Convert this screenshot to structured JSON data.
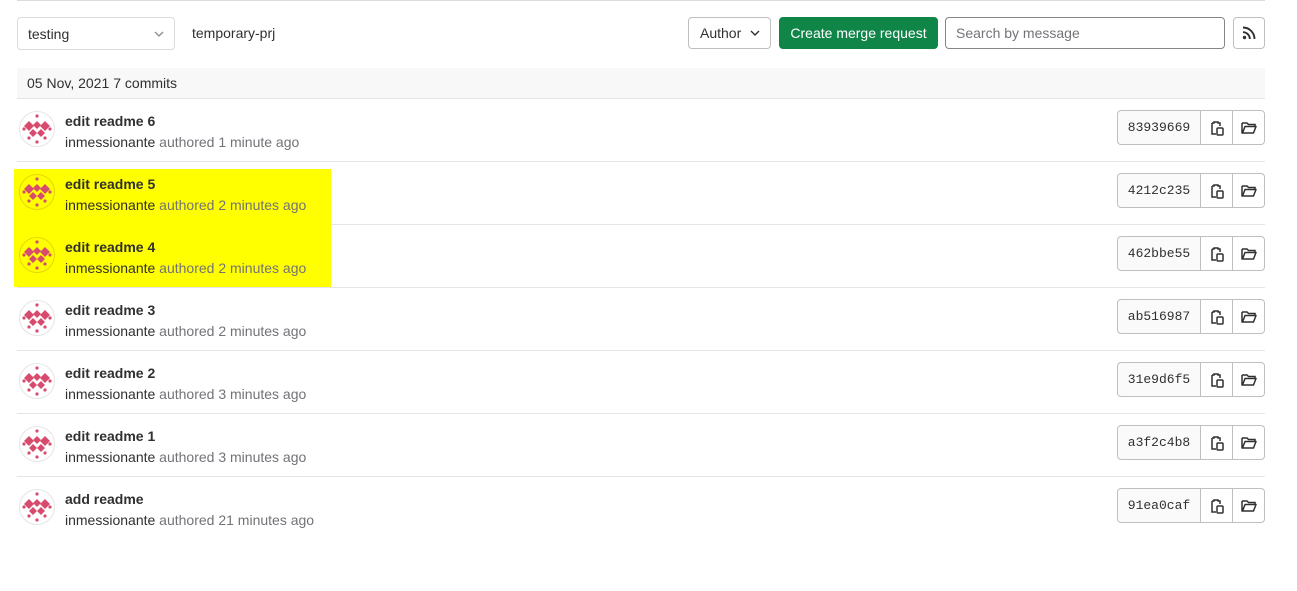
{
  "toolbar": {
    "branch": "testing",
    "path": "temporary-prj",
    "author_label": "Author",
    "merge_request_label": "Create merge request",
    "search_placeholder": "Search by message",
    "rss_icon": "rss-icon"
  },
  "day_header": {
    "date": "05 Nov, 2021",
    "count": "7 commits"
  },
  "colors": {
    "primary_button": "#108548",
    "highlight": "#ffff00",
    "avatar_pattern": "#d74c6e"
  },
  "commits": [
    {
      "title": "edit readme 6",
      "author": "inmessionante",
      "verb": "authored",
      "time": "1 minute ago",
      "sha": "83939669"
    },
    {
      "title": "edit readme 5",
      "author": "inmessionante",
      "verb": "authored",
      "time": "2 minutes ago",
      "sha": "4212c235"
    },
    {
      "title": "edit readme 4",
      "author": "inmessionante",
      "verb": "authored",
      "time": "2 minutes ago",
      "sha": "462bbe55"
    },
    {
      "title": "edit readme 3",
      "author": "inmessionante",
      "verb": "authored",
      "time": "2 minutes ago",
      "sha": "ab516987"
    },
    {
      "title": "edit readme 2",
      "author": "inmessionante",
      "verb": "authored",
      "time": "3 minutes ago",
      "sha": "31e9d6f5"
    },
    {
      "title": "edit readme 1",
      "author": "inmessionante",
      "verb": "authored",
      "time": "3 minutes ago",
      "sha": "a3f2c4b8"
    },
    {
      "title": "add readme",
      "author": "inmessionante",
      "verb": "authored",
      "time": "21 minutes ago",
      "sha": "91ea0caf"
    }
  ]
}
